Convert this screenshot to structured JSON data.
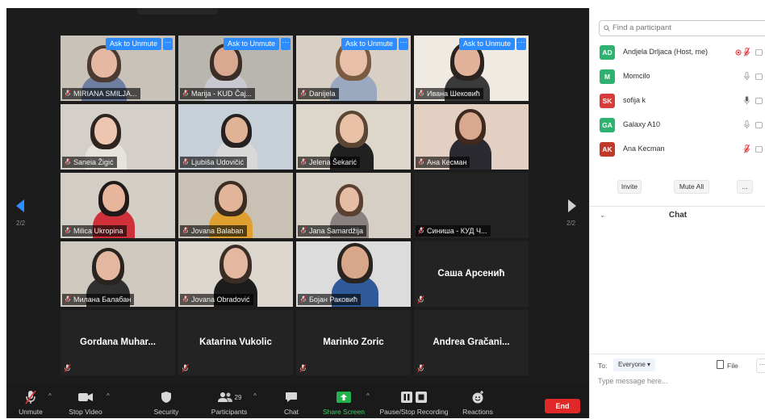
{
  "meeting": {
    "page_indicator_left": "2/2",
    "page_indicator_right": "2/2",
    "unmute_chip_label": "Ask to Unmute",
    "more_chip_label": "···",
    "tiles": [
      {
        "name": "MIRIANA SMILJA...",
        "video": true,
        "ask_unmute": true
      },
      {
        "name": "Marija - KUD Čaj...",
        "video": true,
        "ask_unmute": true
      },
      {
        "name": "Danijela",
        "video": true,
        "ask_unmute": true
      },
      {
        "name": "Ивана Шековић",
        "video": true,
        "ask_unmute": true
      },
      {
        "name": "Saneia Žigić",
        "video": true
      },
      {
        "name": "Ljubiša Udovičić",
        "video": true
      },
      {
        "name": "Jelena Šekarić",
        "video": true
      },
      {
        "name": "Ана Кесман",
        "video": true
      },
      {
        "name": "Milica Ukropina",
        "video": true
      },
      {
        "name": "Jovana Balaban",
        "video": true
      },
      {
        "name": "Jana Samardžija",
        "video": true
      },
      {
        "name": "Синиша - КУД Ч...",
        "video": false,
        "label_style": "tag"
      },
      {
        "name": "Милана Балабан",
        "video": true
      },
      {
        "name": "Jovana Obradović",
        "video": true
      },
      {
        "name": "Бојан Раковић",
        "video": true
      },
      {
        "name": "Саша Арсенић",
        "video": false,
        "label_style": "big"
      },
      {
        "name": "Gordana  Muhar...",
        "video": false,
        "label_style": "big"
      },
      {
        "name": "Katarina Vukolic",
        "video": false,
        "label_style": "big"
      },
      {
        "name": "Marinko Zoric",
        "video": false,
        "label_style": "big"
      },
      {
        "name": "Andrea  Gračani...",
        "video": false,
        "label_style": "big"
      }
    ]
  },
  "toolbar": {
    "unmute": "Unmute",
    "stop_video": "Stop Video",
    "security": "Security",
    "participants": "Participants",
    "participants_count": "29",
    "chat": "Chat",
    "share_screen": "Share Screen",
    "pause_recording": "Pause/Stop Recording",
    "reactions": "Reactions",
    "end": "End"
  },
  "participants_panel": {
    "search_placeholder": "Find a participant",
    "list": [
      {
        "initials": "AD",
        "name": "Andjela Drljaca (Host, me)",
        "color": "#2fb170",
        "mic": "muted",
        "host": true
      },
      {
        "initials": "M",
        "name": "Momcilo",
        "color": "#2fb170",
        "mic": "on"
      },
      {
        "initials": "SK",
        "name": "sofija k",
        "color": "#d93b3b",
        "mic": "speaking"
      },
      {
        "initials": "GA",
        "name": "Galaxy A10",
        "color": "#2fb170",
        "mic": "on"
      },
      {
        "initials": "AK",
        "name": "Ana Kecman",
        "color": "#c0392b",
        "mic": "muted"
      }
    ],
    "invite": "Invite",
    "mute_all": "Mute All",
    "more": "..."
  },
  "chat": {
    "title": "Chat",
    "to_label": "To:",
    "recipient": "Everyone",
    "file_label": "File",
    "more": "···",
    "input_placeholder": "Type message here..."
  }
}
